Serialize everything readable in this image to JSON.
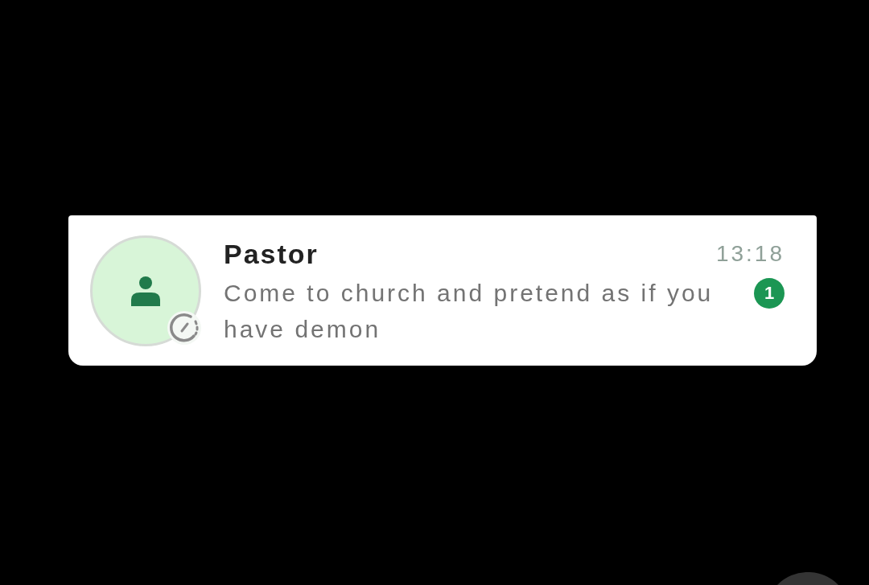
{
  "chat_item": {
    "contact_name": "Pastor",
    "time": "13:18",
    "message_preview": "Come to church and pretend as if you have demon",
    "unread_count": "1",
    "status_ring": true
  }
}
